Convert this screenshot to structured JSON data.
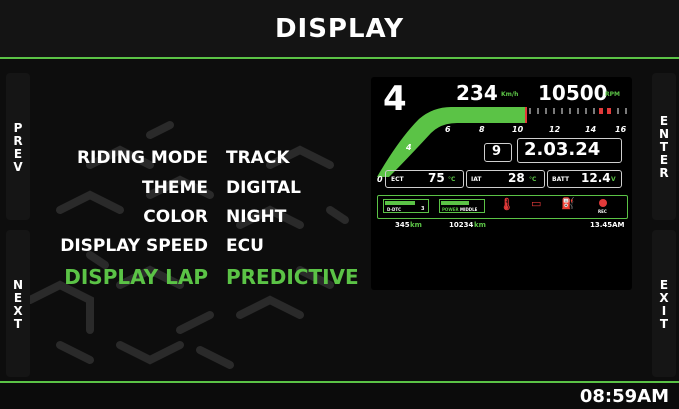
{
  "header": {
    "title": "DISPLAY"
  },
  "side_buttons": {
    "prev": "PREV",
    "next": "NEXT",
    "enter": "ENTER",
    "exit": "EXIT"
  },
  "menu": [
    {
      "label": "RIDING MODE",
      "value": "TRACK",
      "active": false
    },
    {
      "label": "THEME",
      "value": "DIGITAL",
      "active": false
    },
    {
      "label": "COLOR",
      "value": "NIGHT",
      "active": false
    },
    {
      "label": "DISPLAY SPEED",
      "value": "ECU",
      "active": false
    },
    {
      "label": "DISPLAY LAP",
      "value": "PREDICTIVE",
      "active": true
    }
  ],
  "preview": {
    "gear": "4",
    "speed": "234",
    "speed_unit": "Km/h",
    "rpm": "10500",
    "rpm_unit": "RPM",
    "rpm_scale": [
      "0",
      "4",
      "6",
      "8",
      "10",
      "12",
      "14",
      "16"
    ],
    "lap_number": "9",
    "lap_time": "2.03.24",
    "ect_label": "ECT",
    "ect_value": "75",
    "ect_unit": "°C",
    "iat_label": "IAT",
    "iat_value": "28",
    "iat_unit": "°C",
    "batt_label": "BATT",
    "batt_value": "12.4",
    "batt_unit": "V",
    "dtc_label": "D-DTC",
    "dtc_value": "3",
    "power_label": "POWER",
    "power_value": "MIDDLE",
    "rec_label": "REC",
    "trip": "345",
    "trip_unit": "km",
    "odo": "10234",
    "odo_unit": "km",
    "time": "13.45AM",
    "accent_color": "#5bc346"
  },
  "footer": {
    "clock": "08:59AM"
  }
}
